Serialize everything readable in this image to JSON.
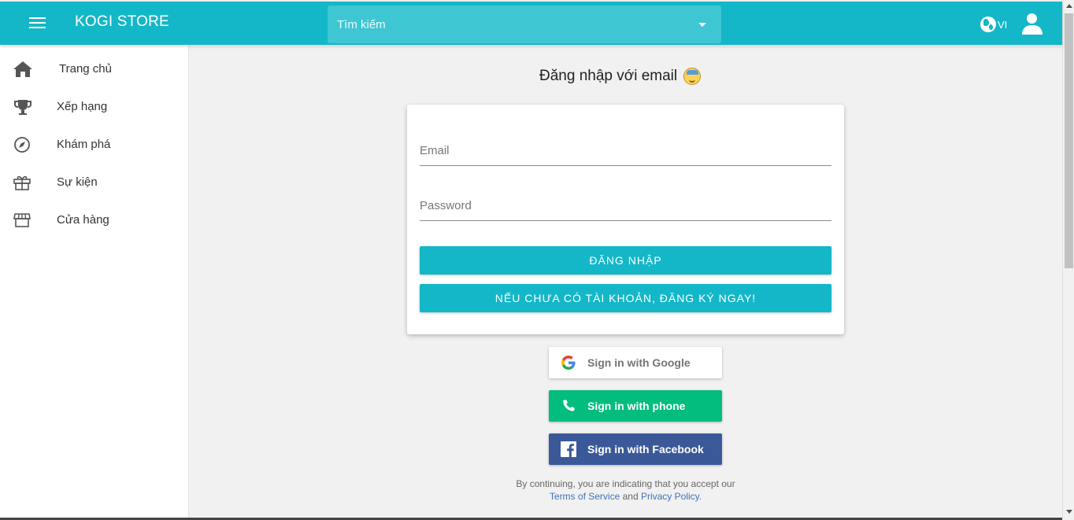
{
  "header": {
    "brand": "KOGI STORE",
    "search_placeholder": "Tìm kiếm",
    "language": "VI",
    "accent_color": "#13b7c8"
  },
  "sidebar": {
    "items": [
      {
        "label": "Trang chủ",
        "icon": "home-icon"
      },
      {
        "label": "Xếp hạng",
        "icon": "trophy-icon"
      },
      {
        "label": "Khám phá",
        "icon": "compass-icon"
      },
      {
        "label": "Sự kiện",
        "icon": "gift-icon"
      },
      {
        "label": "Cửa hàng",
        "icon": "store-icon"
      }
    ]
  },
  "login": {
    "title": "Đăng nhập với email",
    "email_placeholder": "Email",
    "password_placeholder": "Password",
    "login_button": "ĐĂNG NHẬP",
    "register_button": "NẾU CHƯA CÓ TÀI KHOẢN, ĐĂNG KÝ NGAY!"
  },
  "social": {
    "google": "Sign in with Google",
    "phone": "Sign in with phone",
    "facebook": "Sign in with Facebook"
  },
  "terms": {
    "prefix": "By continuing, you are indicating that you accept our",
    "tos": "Terms of Service",
    "and": "and",
    "privacy": "Privacy Policy",
    "suffix": "."
  }
}
